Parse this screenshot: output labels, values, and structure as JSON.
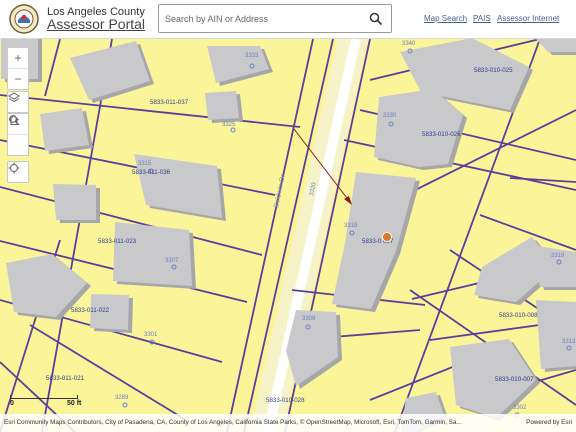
{
  "header": {
    "county": "Los Angeles County",
    "portal_title": "Assessor Portal"
  },
  "search": {
    "placeholder": "Search by AIN or Address"
  },
  "nav": {
    "map_search": "Map Search",
    "pais": "PAIS",
    "assessor_internet": "Assessor Internet"
  },
  "map": {
    "zoom_in": "+",
    "zoom_out": "−",
    "street_name": "Baldwin Dr",
    "parcels": [
      "5833-011-037",
      "5833-011-036",
      "5833-011-023",
      "5833-011-022",
      "5833-011-021",
      "5833-010-025",
      "5833-010-026",
      "5833-0  027",
      "5833-010-008",
      "5833-010-007",
      "5833-010-028"
    ],
    "addresses": [
      "3340",
      "3333",
      "3325",
      "3315",
      "3307",
      "3301",
      "3289",
      "3330",
      "3318",
      "3320",
      "3308",
      "3313",
      "3302",
      "3319"
    ],
    "colors": {
      "parcel_fill": "#fbf59a",
      "parcel_line": "#5b3f9d",
      "building": "#c9c9cb",
      "marker": "#d97a2b"
    }
  },
  "scalebar": {
    "start": "0",
    "end": "50 ft"
  },
  "attribution": {
    "text": "Esri Community Maps Contributors, City of Pasadena, CA, County of Los Angeles, California State Parks, © OpenStreetMap, Microsoft, Esri, TomTom, Garmin, Sa...",
    "powered": "Powered by Esri"
  }
}
